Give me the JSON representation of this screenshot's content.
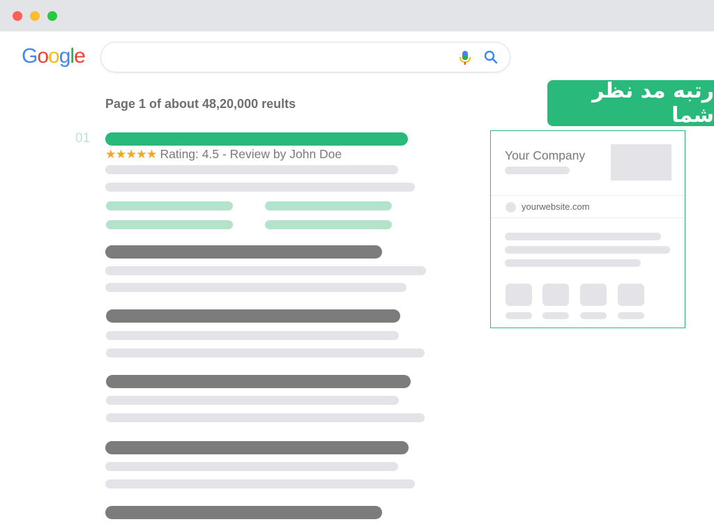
{
  "window": {
    "buttons": [
      "close",
      "minimize",
      "maximize"
    ]
  },
  "logo": {
    "letters": [
      {
        "char": "G",
        "color": "#4285f4"
      },
      {
        "char": "o",
        "color": "#ea4335"
      },
      {
        "char": "o",
        "color": "#fbbc05"
      },
      {
        "char": "g",
        "color": "#4285f4"
      },
      {
        "char": "l",
        "color": "#34a853"
      },
      {
        "char": "e",
        "color": "#ea4335"
      }
    ]
  },
  "search": {
    "value": "",
    "mic_icon": "microphone-icon",
    "search_icon": "magnifier-icon"
  },
  "results": {
    "count_text": "Page 1 of about 48,20,000 reults",
    "first": {
      "rank": "01",
      "stars": "★★★★★",
      "rating_text": "Rating: 4.5 - Review by John Doe"
    }
  },
  "badge": {
    "text": "رتبه مد نظر شما"
  },
  "knowledge_panel": {
    "company": "Your Company",
    "website": "yourwebsite.com"
  },
  "colors": {
    "accent_green": "#28b97b",
    "placeholder_gray": "#e4e4e8",
    "title_gray": "#7c7c7c"
  }
}
